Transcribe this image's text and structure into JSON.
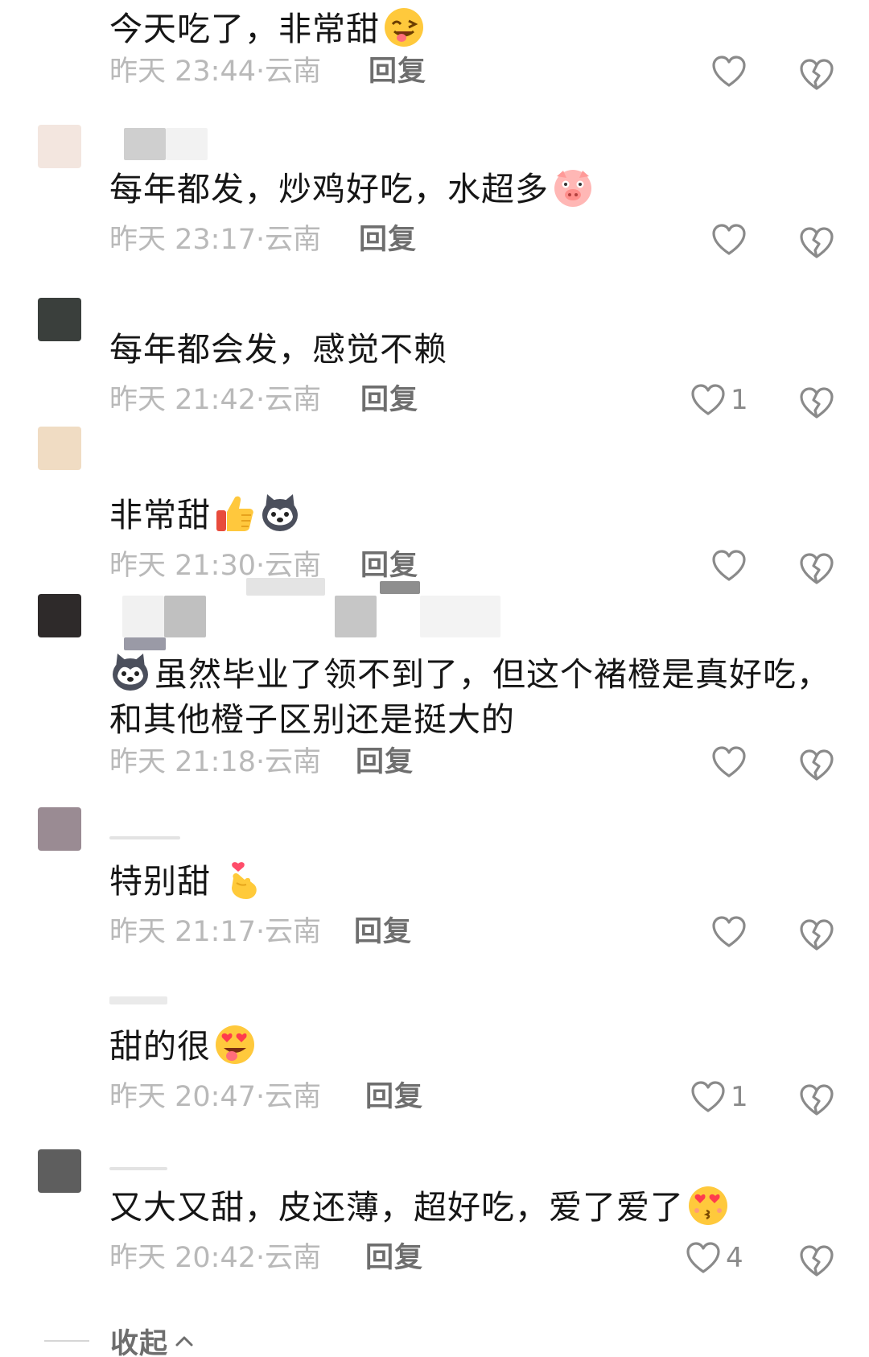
{
  "comments": [
    {
      "text": "今天吃了，非常甜",
      "emoji": "wink-tongue-emoji",
      "time": "昨天 23:44",
      "location": "云南",
      "reply": "回复",
      "likes": ""
    },
    {
      "text": "每年都发，炒鸡好吃，水超多",
      "emoji": "pig-emoji",
      "time": "昨天 23:17",
      "location": "云南",
      "reply": "回复",
      "likes": ""
    },
    {
      "text": "每年都会发，感觉不赖",
      "emoji": "",
      "time": "昨天 21:42",
      "location": "云南",
      "reply": "回复",
      "likes": "1"
    },
    {
      "text": "非常甜",
      "emoji": "thumbs-up-emoji, husky-emoji",
      "time": "昨天 21:30",
      "location": "云南",
      "reply": "回复",
      "likes": ""
    },
    {
      "text_line1": "虽然毕业了领不到了，但这个褚橙是真好吃，",
      "text_line2": "和其他橙子区别还是挺大的",
      "emoji": "husky-emoji",
      "time": "昨天 21:18",
      "location": "云南",
      "reply": "回复",
      "likes": ""
    },
    {
      "text": "特别甜",
      "emoji": "finger-heart-emoji",
      "time": "昨天 21:17",
      "location": "云南",
      "reply": "回复",
      "likes": ""
    },
    {
      "text": "甜的很",
      "emoji": "heart-eyes-tongue-emoji",
      "time": "昨天 20:47",
      "location": "云南",
      "reply": "回复",
      "likes": "1"
    },
    {
      "text": "又大又甜，皮还薄，超好吃，爱了爱了",
      "emoji": "kiss-heart-eyes-emoji",
      "time": "昨天 20:42",
      "location": "云南",
      "reply": "回复",
      "likes": "4"
    }
  ],
  "collapse_label": "收起",
  "colors": {
    "text": "#161616",
    "meta": "#b9b9b9",
    "reply": "#6e6e6e",
    "icon_stroke": "#8a8a8a"
  }
}
